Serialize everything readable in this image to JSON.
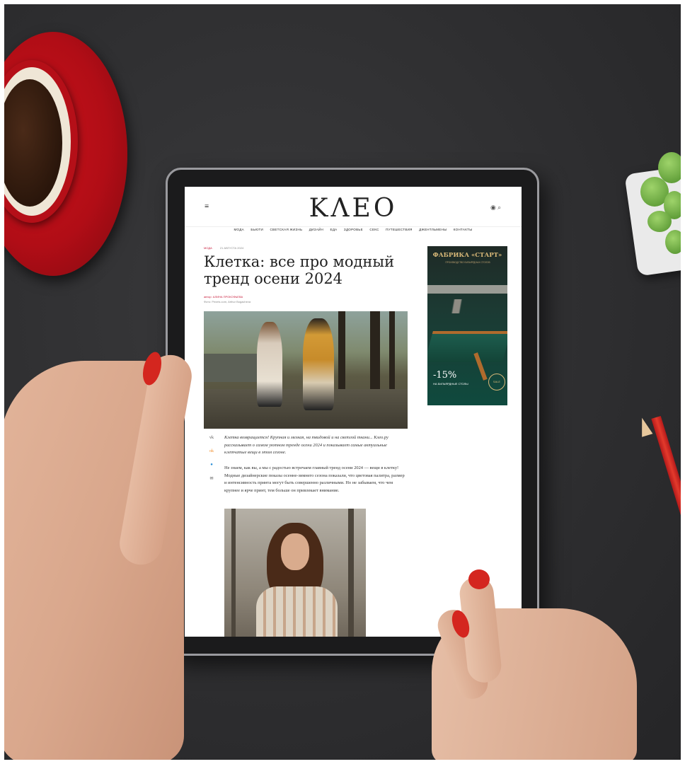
{
  "site": {
    "logo": "KΛEO",
    "nav": [
      "МОДА",
      "БЬЮТИ",
      "СВЕТСКАЯ ЖИЗНЬ",
      "ДИЗАЙН",
      "ЕДА",
      "ЗДОРОВЬЕ",
      "СЕКС",
      "ПУТЕШЕСТВИЯ",
      "ДЖЕНТЛЬМЕНЫ",
      "КОНТАКТЫ"
    ],
    "menu_icon": "hamburger-icon",
    "top_icons": [
      "globe-icon",
      "search-icon"
    ]
  },
  "article": {
    "category": "МОДА",
    "date": "21 АВГУСТА 2024",
    "title": "Клетка: все про модный тренд осени 2024",
    "author_line": "автор: АЛИНА ПРОКОФЬЕВА",
    "photo_line": "Фото: Pexels.com, Arthur Bogacheva",
    "lead": "Клетка возвращается! Крупная и мелкая, на твидовой и на светлой ткани... Клео.ру рассказывает о самом уютном тренде осени 2024 и показывает самые актуальные клетчатые вещи в этом сезоне.",
    "body": "Не знаем, как вы, а мы с радостью встречаем главный тренд осени 2024 — вещи в клетку! Модные дизайнерские показы осенне-зимнего сезона показали, что цветовая палитра, размер и интенсивность принта могут быть совершенно различными. Но не забываем, что чем крупнее и ярче принт, тем больше он привлекает внимание.",
    "share_icons": [
      "vk-icon",
      "ok-icon",
      "telegram-icon",
      "mail-icon"
    ]
  },
  "ad": {
    "brand": "ФАБРИКА «СТАРТ»",
    "subtitle": "ПРОИЗВОДСТВО БИЛЬЯРДНЫХ СТОЛОВ",
    "discount": "-15%",
    "caption": "НА БИЛЬЯРДНЫЕ СТОЛЫ",
    "badge": "SALE"
  }
}
